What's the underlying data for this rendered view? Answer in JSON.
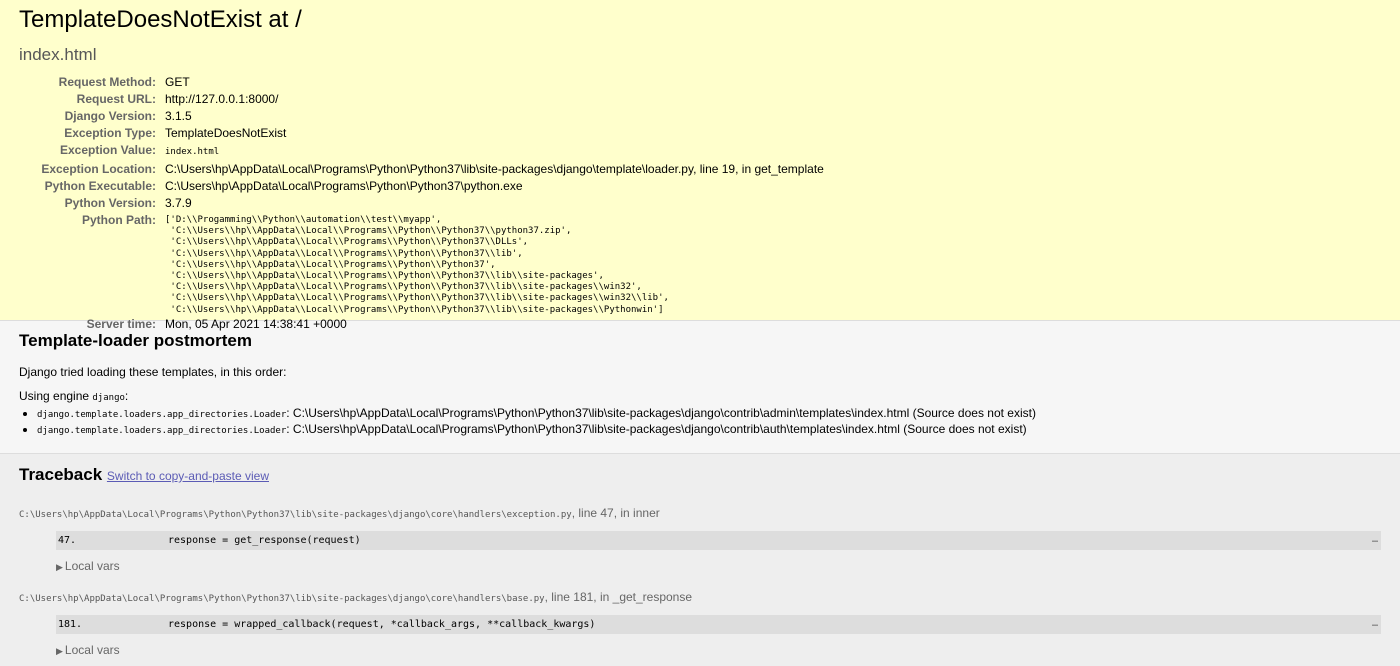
{
  "summary": {
    "title": "TemplateDoesNotExist at /",
    "exception_value_heading": "index.html",
    "meta": [
      {
        "label": "Request Method:",
        "value": "GET"
      },
      {
        "label": "Request URL:",
        "value": "http://127.0.0.1:8000/"
      },
      {
        "label": "Django Version:",
        "value": "3.1.5"
      },
      {
        "label": "Exception Type:",
        "value": "TemplateDoesNotExist"
      },
      {
        "label": "Exception Value:",
        "value": "index.html"
      },
      {
        "label": "Exception Location:",
        "value": "C:\\Users\\hp\\AppData\\Local\\Programs\\Python\\Python37\\lib\\site-packages\\django\\template\\loader.py, line 19, in get_template"
      },
      {
        "label": "Python Executable:",
        "value": "C:\\Users\\hp\\AppData\\Local\\Programs\\Python\\Python37\\python.exe"
      },
      {
        "label": "Python Version:",
        "value": "3.7.9"
      },
      {
        "label": "Python Path:",
        "value": "['D:\\\\Progamming\\\\Python\\\\automation\\\\test\\\\myapp',\n 'C:\\\\Users\\\\hp\\\\AppData\\\\Local\\\\Programs\\\\Python\\\\Python37\\\\python37.zip',\n 'C:\\\\Users\\\\hp\\\\AppData\\\\Local\\\\Programs\\\\Python\\\\Python37\\\\DLLs',\n 'C:\\\\Users\\\\hp\\\\AppData\\\\Local\\\\Programs\\\\Python\\\\Python37\\\\lib',\n 'C:\\\\Users\\\\hp\\\\AppData\\\\Local\\\\Programs\\\\Python\\\\Python37',\n 'C:\\\\Users\\\\hp\\\\AppData\\\\Local\\\\Programs\\\\Python\\\\Python37\\\\lib\\\\site-packages',\n 'C:\\\\Users\\\\hp\\\\AppData\\\\Local\\\\Programs\\\\Python\\\\Python37\\\\lib\\\\site-packages\\\\win32',\n 'C:\\\\Users\\\\hp\\\\AppData\\\\Local\\\\Programs\\\\Python\\\\Python37\\\\lib\\\\site-packages\\\\win32\\\\lib',\n 'C:\\\\Users\\\\hp\\\\AppData\\\\Local\\\\Programs\\\\Python\\\\Python37\\\\lib\\\\site-packages\\\\Pythonwin']"
      },
      {
        "label": "Server time:",
        "value": "Mon, 05 Apr 2021 14:38:41 +0000"
      }
    ]
  },
  "postmortem": {
    "heading": "Template-loader postmortem",
    "intro": "Django tried loading these templates, in this order:",
    "engine_prefix": "Using engine ",
    "engine_name": "django",
    "engine_suffix": ":",
    "items": [
      {
        "loader": "django.template.loaders.app_directories.Loader",
        "sep": ": ",
        "path": "C:\\Users\\hp\\AppData\\Local\\Programs\\Python\\Python37\\lib\\site-packages\\django\\contrib\\admin\\templates\\index.html (Source does not exist)"
      },
      {
        "loader": "django.template.loaders.app_directories.Loader",
        "sep": ": ",
        "path": "C:\\Users\\hp\\AppData\\Local\\Programs\\Python\\Python37\\lib\\site-packages\\django\\contrib\\auth\\templates\\index.html (Source does not exist)"
      }
    ]
  },
  "traceback": {
    "heading": "Traceback",
    "switch_link": "Switch to copy-and-paste view",
    "frames": [
      {
        "file": "C:\\Users\\hp\\AppData\\Local\\Programs\\Python\\Python37\\lib\\site-packages\\django\\core\\handlers\\exception.py",
        "location": ", line 47, in inner",
        "lineno": "47.",
        "code": "response = get_response(request)",
        "ellipsis": "…",
        "local_vars": "Local vars"
      },
      {
        "file": "C:\\Users\\hp\\AppData\\Local\\Programs\\Python\\Python37\\lib\\site-packages\\django\\core\\handlers\\base.py",
        "location": ", line 181, in _get_response",
        "lineno": "181.",
        "code": "response = wrapped_callback(request, *callback_args, **callback_kwargs)",
        "ellipsis": "…",
        "local_vars": "Local vars"
      }
    ]
  }
}
